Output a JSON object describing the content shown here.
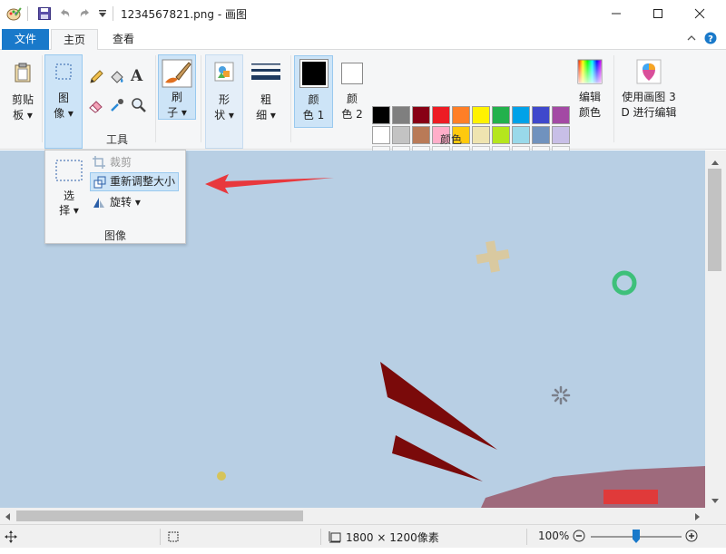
{
  "title_bar": {
    "title": "1234567821.png - 画图",
    "minimize_icon": "minimize-icon",
    "maximize_icon": "maximize-icon",
    "close_icon": "close-icon"
  },
  "tabs": [
    {
      "label": "文件"
    },
    {
      "label": "主页"
    },
    {
      "label": "查看"
    }
  ],
  "ribbon": {
    "clipboard": {
      "label_line1": "剪贴",
      "label_line2": "板 ▾"
    },
    "image": {
      "label_line1": "图",
      "label_line2": "像 ▾"
    },
    "tools": {
      "group_label": "工具"
    },
    "brushes": {
      "label_line1": "刷",
      "label_line2": "子 ▾"
    },
    "shapes": {
      "label_line1": "形",
      "label_line2": "状 ▾"
    },
    "size": {
      "label_line1": "粗",
      "label_line2": "细 ▾"
    },
    "color1": {
      "label_line1": "颜",
      "label_line2": "色 1",
      "value": "#000000"
    },
    "color2": {
      "label_line1": "颜",
      "label_line2": "色 2",
      "value": "#ffffff"
    },
    "colors_group_label": "颜色",
    "edit_colors": {
      "label_line1": "编辑",
      "label_line2": "颜色"
    },
    "paint3d": {
      "label_line1": "使用画图 3",
      "label_line2": "D 进行编辑"
    },
    "palette_row1": [
      "#000000",
      "#7f7f7f",
      "#880015",
      "#ed1c24",
      "#ff7f27",
      "#fff200",
      "#22b14c",
      "#00a2e8",
      "#3f48cc",
      "#a349a4"
    ],
    "palette_row2": [
      "#ffffff",
      "#c3c3c3",
      "#b97a57",
      "#ffaec9",
      "#ffc90e",
      "#efe4b0",
      "#b5e61d",
      "#99d9ea",
      "#7092be",
      "#c8bfe7"
    ]
  },
  "image_dropdown": {
    "select_line1": "选",
    "select_line2": "择 ▾",
    "crop": "裁剪",
    "resize": "重新调整大小",
    "rotate": "旋转 ▾",
    "group_label": "图像"
  },
  "status_bar": {
    "image_size": "1800 × 1200像素",
    "zoom": "100%",
    "zoom_fraction": 0.5
  },
  "colors": {
    "accent": "#1979ca",
    "canvas_bg": "#b8cfe4",
    "annotation_arrow": "#e8383d"
  }
}
